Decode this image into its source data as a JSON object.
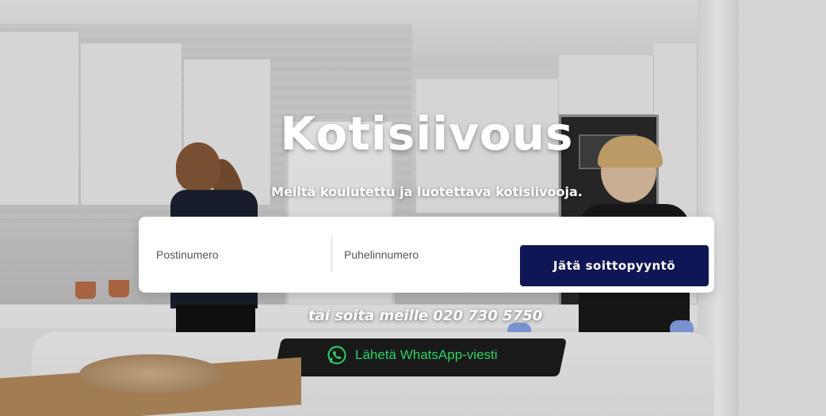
{
  "hero": {
    "title": "Kotisiivous",
    "subtitle": "Meiltä koulutettu ja luotettava kotisiivooja."
  },
  "form": {
    "postal_placeholder": "Postinumero",
    "phone_placeholder": "Puhelinnumero",
    "submit_label": "Jätä soittopyyntö"
  },
  "contact": {
    "call_text": "tai soita meille 020 730 5750",
    "whatsapp_label": "Lähetä WhatsApp-viesti",
    "whatsapp_icon": "whatsapp-icon"
  },
  "colors": {
    "button_bg": "#0f1656",
    "whatsapp_green": "#25d366"
  }
}
